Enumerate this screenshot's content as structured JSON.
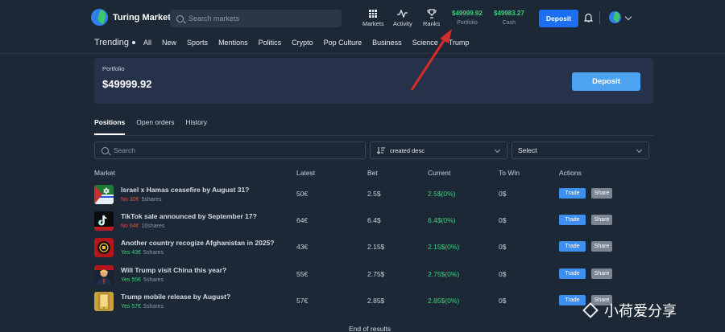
{
  "header": {
    "logo_text": "Turing Market",
    "search_placeholder": "Search markets",
    "nav": [
      {
        "label": "Markets",
        "icon": "grid-icon"
      },
      {
        "label": "Activity",
        "icon": "activity-icon"
      },
      {
        "label": "Ranks",
        "icon": "trophy-icon"
      }
    ],
    "portfolio_value": "$49999.92",
    "portfolio_label": "Portfolio",
    "cash_value": "$49983.27",
    "cash_label": "Cash",
    "deposit_label": "Deposit"
  },
  "categories": {
    "trending": "Trending",
    "items": [
      "All",
      "New",
      "Sports",
      "Mentions",
      "Politics",
      "Crypto",
      "Pop Culture",
      "Business",
      "Science",
      "Trump"
    ]
  },
  "portfolio_card": {
    "label": "Portfolio",
    "value": "$49999.92",
    "deposit_label": "Deposit"
  },
  "tabs": [
    "Positions",
    "Open orders",
    "History"
  ],
  "filters": {
    "search_placeholder": "Search",
    "sort_value": "created desc",
    "select_value": "Select"
  },
  "table": {
    "columns": [
      "Market",
      "Latest",
      "Bet",
      "Current",
      "To Win",
      "Actions"
    ],
    "rows": [
      {
        "title": "Israel x Hamas ceasefire by August 31?",
        "side": "No 30€",
        "side_type": "no",
        "shares": "5shares",
        "latest": "50€",
        "bet": "2.5$",
        "current": "2.5$(0%)",
        "to_win": "0$",
        "thumb": "flag-thumbnail"
      },
      {
        "title": "TikTok sale announced by September 17?",
        "side": "No 64€",
        "side_type": "no",
        "shares": "10shares",
        "latest": "64€",
        "bet": "6.4$",
        "current": "6.4$(0%)",
        "to_win": "0$",
        "thumb": "tiktok-thumbnail"
      },
      {
        "title": "Another country recogize Afghanistan in 2025?",
        "side": "Yes 43€",
        "side_type": "yes",
        "shares": "5shares",
        "latest": "43€",
        "bet": "2.15$",
        "current": "2.15$(0%)",
        "to_win": "0$",
        "thumb": "emblem-thumbnail"
      },
      {
        "title": "Will Trump visit China this year?",
        "side": "Yes 55€",
        "side_type": "yes",
        "shares": "5shares",
        "latest": "55€",
        "bet": "2.75$",
        "current": "2.75$(0%)",
        "to_win": "0$",
        "thumb": "portrait-thumbnail"
      },
      {
        "title": "Trump mobile release by August?",
        "side": "Yes 57€",
        "side_type": "yes",
        "shares": "5shares",
        "latest": "57€",
        "bet": "2.85$",
        "current": "2.85$(0%)",
        "to_win": "0$",
        "thumb": "phone-thumbnail"
      }
    ],
    "trade_label": "Trade",
    "share_label": "Share",
    "end_text": "End of results"
  },
  "watermark": "小荷爱分享",
  "colors": {
    "background": "#1d2836",
    "accent": "#1d6ff2",
    "positive": "#3fd07a",
    "negative": "#ef4444",
    "annotation": "#d42b2b"
  }
}
